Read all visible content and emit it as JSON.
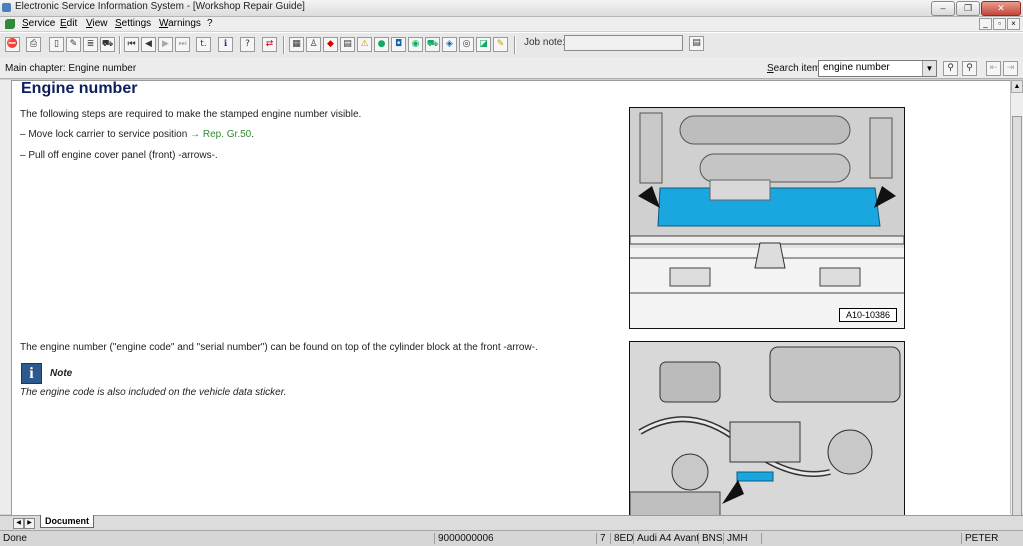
{
  "window": {
    "title": "Electronic Service Information System - [Workshop Repair Guide]"
  },
  "menu": {
    "items": [
      "Service",
      "Edit",
      "View",
      "Settings",
      "Warnings",
      "?"
    ]
  },
  "toolbar": {
    "job_note_label": "Job note:",
    "job_note_value": ""
  },
  "header": {
    "main_chapter": "Main chapter: Engine number",
    "search_label": "Search item:",
    "search_value": "engine number"
  },
  "content": {
    "title": "Engine number",
    "intro": "The following steps are required to make the stamped engine number visible.",
    "step1_prefix": "–   Move lock carrier to service position",
    "step1_link": "→ Rep. Gr.50",
    "step1_suffix": ".",
    "step2": "–   Pull off engine cover panel (front) -arrows-.",
    "para2": "The engine number (\"engine code\" and \"serial number\") can be found on top of the cylinder block at the front -arrow-.",
    "note_title": "Note",
    "note_text": "The engine code is also included on the vehicle data sticker.",
    "figure1_label": "A10-10386"
  },
  "tabs": {
    "document": "Document"
  },
  "status": {
    "left": "Done",
    "number": "9000000006",
    "c1": "7",
    "c2": "8ED",
    "vehicle": "Audi A4 Avant",
    "c4": "BNS",
    "c5": "JMH",
    "user": "PETER"
  },
  "colors": {
    "title_blue": "#0d1f5c",
    "link_green": "#2e8b2e",
    "highlight_cyan": "#1aa7e0"
  }
}
